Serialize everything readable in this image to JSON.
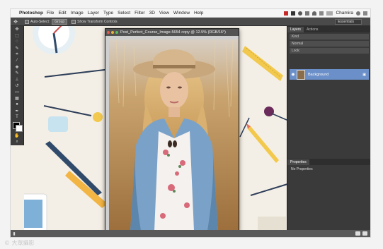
{
  "menubar": {
    "app_name": "Photoshop",
    "items": [
      "File",
      "Edit",
      "Image",
      "Layer",
      "Type",
      "Select",
      "Filter",
      "3D",
      "View",
      "Window",
      "Help"
    ],
    "user": "Chamira"
  },
  "options": {
    "auto_select": "Auto-Select:",
    "auto_select_value": "Group",
    "show_transform": "Show Transform Controls",
    "workspace": "Essentials"
  },
  "document": {
    "title": "Post_Perfect_Course_Image-5654 copy @ 12.5% (RGB/16*)"
  },
  "layers_panel": {
    "tabs": [
      "Layers",
      "Actions"
    ],
    "kind_label": "Kind",
    "mode_label": "Normal",
    "lock_label": "Lock:",
    "layer_name": "Background"
  },
  "properties_panel": {
    "tab": "Properties",
    "text": "No Properties"
  },
  "watermark": "© 大眾攝影"
}
